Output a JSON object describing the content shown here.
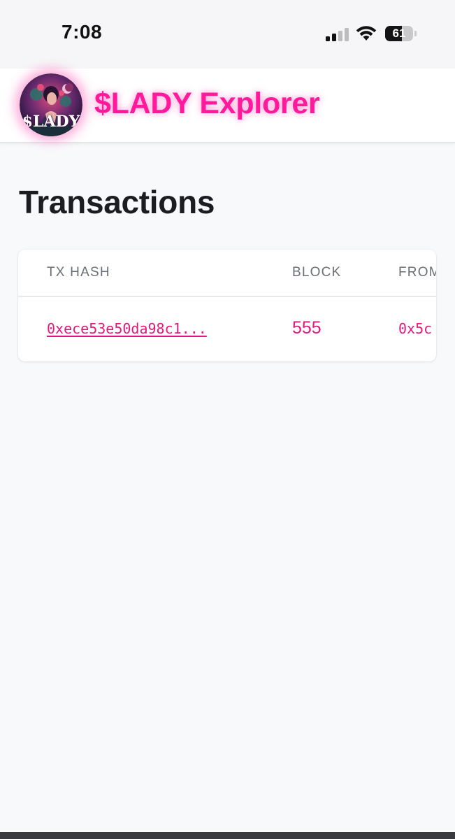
{
  "status_bar": {
    "time": "7:08",
    "battery_level": "61",
    "battery_fraction": 0.61,
    "icons": [
      "signal-icon",
      "wifi-icon",
      "battery-icon"
    ]
  },
  "header": {
    "logo_text": "$LADY",
    "title": "$LADY Explorer"
  },
  "page": {
    "title": "Transactions"
  },
  "table": {
    "columns": [
      "TX HASH",
      "BLOCK",
      "FROM"
    ],
    "rows": [
      {
        "tx_hash": "0xece53e50da98c1...",
        "block": "555",
        "from": "0x5c"
      }
    ]
  },
  "colors": {
    "accent": "#ff1a9c",
    "link": "#e3177f",
    "background": "#f8f9fb",
    "header_text": "#6b6e76"
  }
}
